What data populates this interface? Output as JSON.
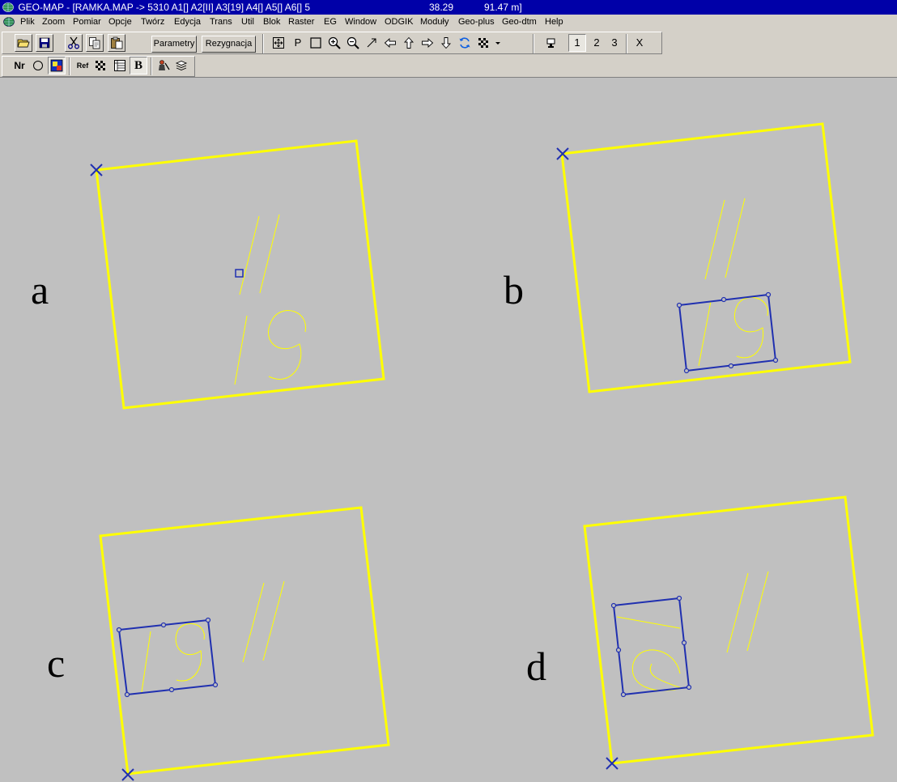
{
  "titlebar": {
    "title": "GEO-MAP - [RAMKA.MAP -> 5310 A1[]  A2[II]  A3[19]  A4[]  A5[]  A6[]  5",
    "coord1": "38.29",
    "coord2": "91.47 m]"
  },
  "menu": {
    "items": [
      "Plik",
      "Zoom",
      "Pomiar",
      "Opcje",
      "Twórz",
      "Edycja",
      "Trans",
      "Util",
      "Blok",
      "Raster",
      "EG",
      "Window",
      "ODGIK",
      "Moduły",
      "Geo-plus",
      "Geo-dtm",
      "Help"
    ]
  },
  "toolbar1": {
    "parametry": "Parametry",
    "rezygnacja": "Rezygnacja",
    "p_label": "P",
    "layer1": "1",
    "layer2": "2",
    "layer3": "3",
    "close_x": "X"
  },
  "toolbar2": {
    "nr_label": "Nr",
    "ref_label": "Ref",
    "b_label": "B"
  },
  "panels": {
    "a": "a",
    "b": "b",
    "c": "c",
    "d": "d"
  },
  "colors": {
    "frame": "#ffff00",
    "selection": "#2030b0",
    "canvas": "#c0c0c0",
    "titlebar": "#0000a8"
  }
}
